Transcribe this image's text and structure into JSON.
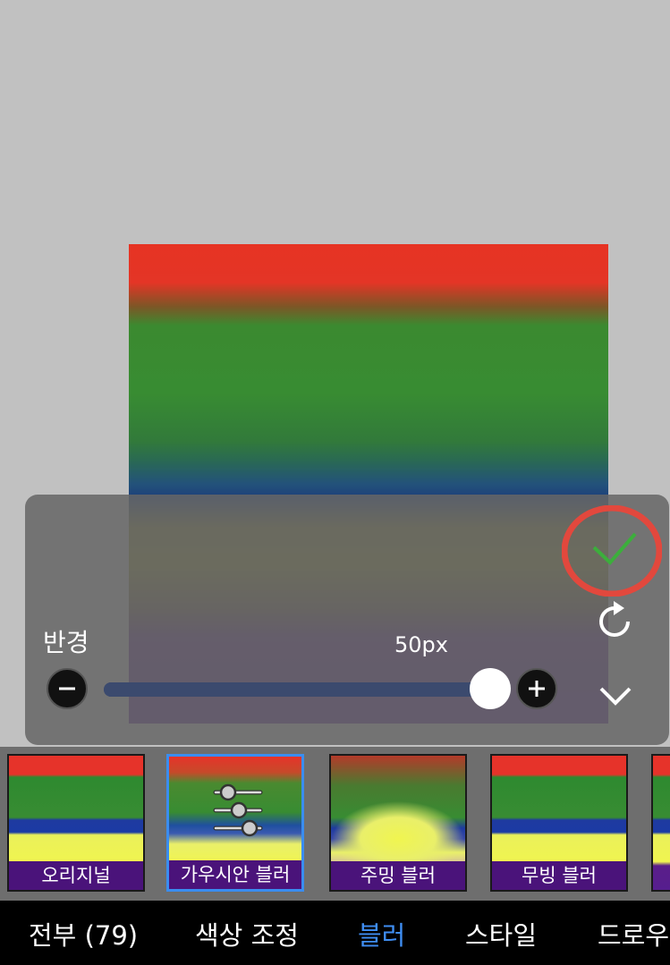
{
  "panel": {
    "radius_label": "반경",
    "radius_value": "50px",
    "slider_fraction": 1.0
  },
  "icons": {
    "apply": "checkmark-icon",
    "reset": "rotate-cw-icon",
    "collapse": "chevron-down-icon",
    "minus": "minus-icon",
    "plus": "plus-icon",
    "adjust": "sliders-icon"
  },
  "filters": [
    {
      "label": "오리지널"
    },
    {
      "label": "가우시안 블러",
      "selected": true
    },
    {
      "label": "주밍 블러"
    },
    {
      "label": "무빙 블러"
    }
  ],
  "tabs": [
    {
      "label": "전부 (79)"
    },
    {
      "label": "색상 조정"
    },
    {
      "label": "블러",
      "active": true
    },
    {
      "label": "스타일"
    },
    {
      "label": "드로우"
    }
  ],
  "colors": {
    "accent": "#3f8ef3",
    "apply_check": "#3cae3c",
    "highlight_circle": "#e2483d"
  }
}
